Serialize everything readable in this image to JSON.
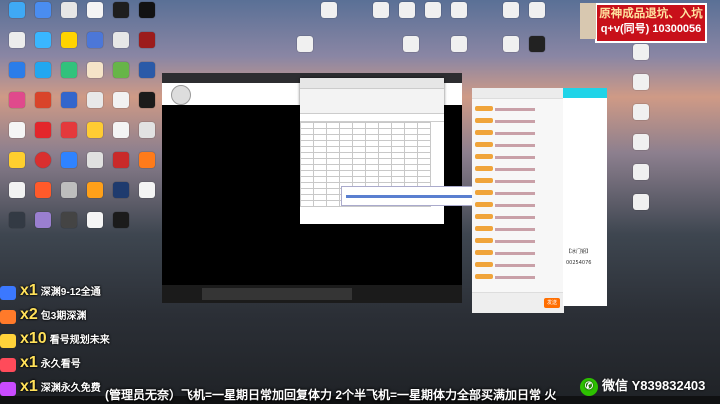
{
  "ad": {
    "line1": "原神成品退坑、入坑",
    "line2": "q+v(同号) 10300056"
  },
  "overlay_list": [
    {
      "count": "x1",
      "text": "深渊9-12全通",
      "color": "#3b78ff"
    },
    {
      "count": "x2",
      "text": "包3期深渊",
      "color": "#ff7a2a"
    },
    {
      "count": "x10",
      "text": "看号规划未来",
      "color": "#ffd23a"
    },
    {
      "count": "x1",
      "text": "永久看号",
      "color": "#ff4b5a"
    },
    {
      "count": "x1",
      "text": "深渊永久免费",
      "color": "#c94bff"
    }
  ],
  "ticker": "(管理员无奈）飞机=一星期日常加回复体力 2个半飞机=一星期体力全部买满加日常 火",
  "wechat": {
    "label": "微信",
    "id": "Y839832403"
  },
  "chat_footer_button": "发送",
  "side_panel_text": [
    "【冰门钥】",
    "00254076"
  ],
  "colors": {
    "ad_bg": "#c8101a",
    "chat_badge": "#f0a43a",
    "send_button": "#ff6e00",
    "side_header": "#1fd4e8",
    "wechat": "#2dc100"
  }
}
